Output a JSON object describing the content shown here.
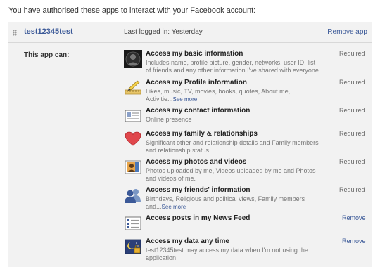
{
  "intro": "You have authorised these apps to interact with your Facebook account:",
  "app": {
    "name": "test12345test",
    "last_login": "Last logged in: Yesterday",
    "remove_label": "Remove app"
  },
  "can_label": "This app can:",
  "colors": {
    "link": "#3b5998",
    "panel": "#f2f2f2"
  },
  "permissions": [
    {
      "icon": "avatar-icon",
      "title": "Access my basic information",
      "desc": "Includes name, profile picture, gender, networks, user ID, list of friends and any other information I've shared with everyone.",
      "more": "",
      "status": "Required"
    },
    {
      "icon": "profile-info-icon",
      "title": "Access my Profile information",
      "desc": "Likes, music, TV, movies, books, quotes, About me, Activitie...",
      "more": "See more",
      "status": "Required"
    },
    {
      "icon": "contact-card-icon",
      "title": "Access my contact information",
      "desc": "Online presence",
      "more": "",
      "status": "Required"
    },
    {
      "icon": "heart-icon",
      "title": "Access my family & relationships",
      "desc": "Significant other and relationship details and Family members and relationship status",
      "more": "",
      "status": "Required"
    },
    {
      "icon": "photo-icon",
      "title": "Access my photos and videos",
      "desc": "Photos uploaded by me, Videos uploaded by me and Photos and videos of me.",
      "more": "",
      "status": "Required"
    },
    {
      "icon": "friends-icon",
      "title": "Access my friends' information",
      "desc": "Birthdays, Religious and political views, Family members and...",
      "more": "See more",
      "status": "Required"
    },
    {
      "icon": "news-feed-icon",
      "title": "Access posts in my News Feed",
      "desc": "",
      "more": "",
      "status": "Remove"
    },
    {
      "icon": "offline-access-icon",
      "title": "Access my data any time",
      "desc": "test12345test may access my data when I'm not using the application",
      "more": "",
      "status": "Remove"
    }
  ]
}
